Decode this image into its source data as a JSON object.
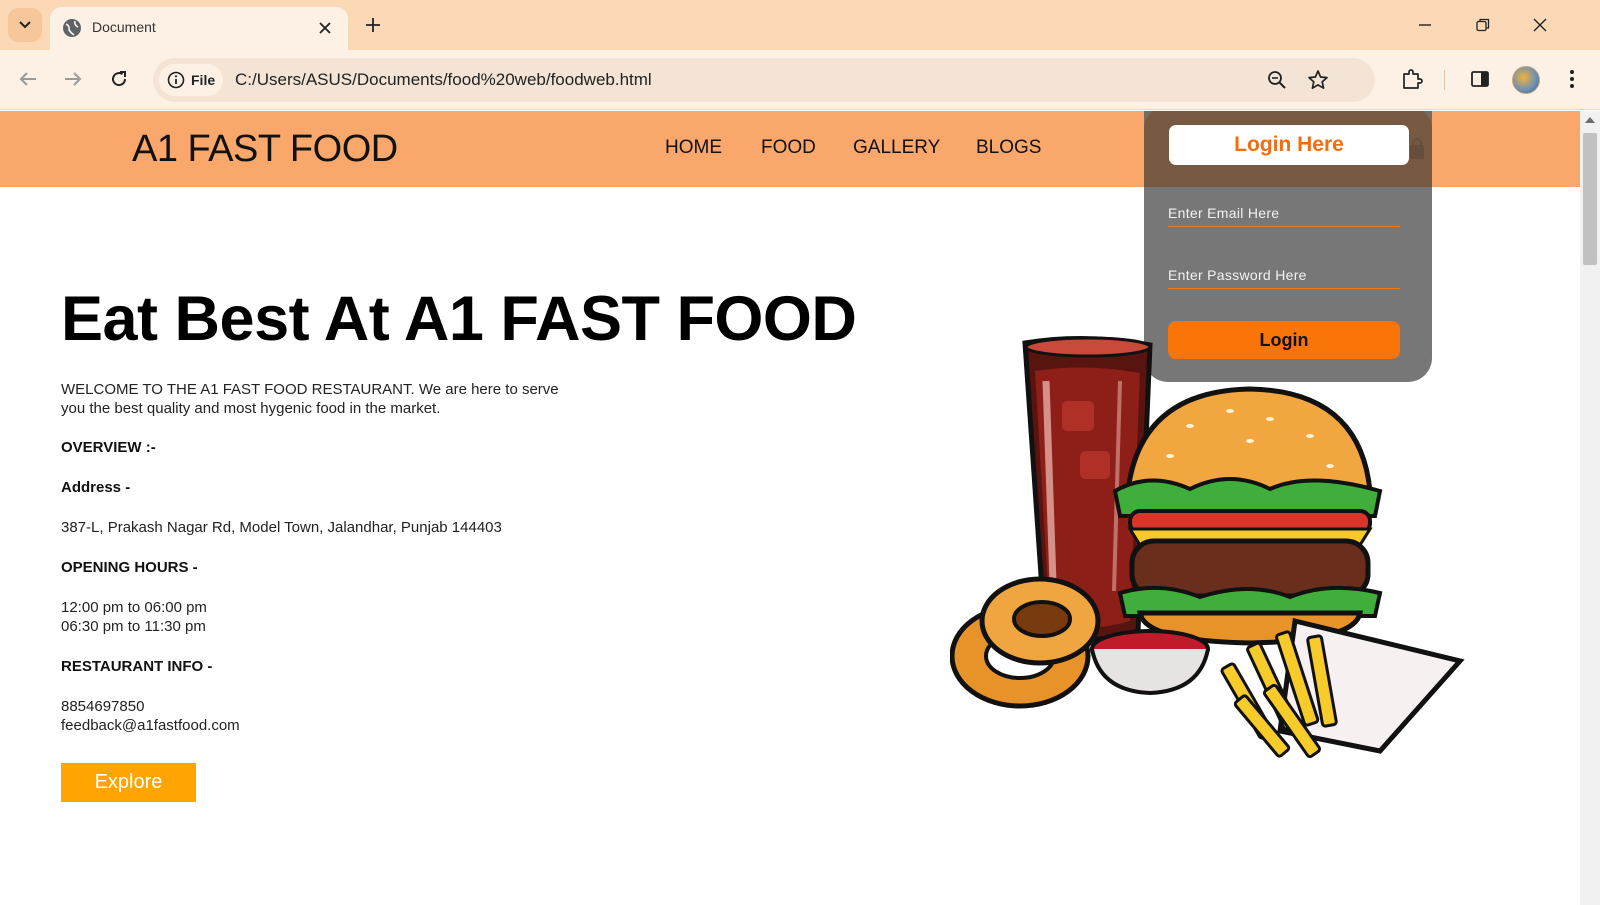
{
  "browser": {
    "tab_title": "Document",
    "file_chip_label": "File",
    "url": "C:/Users/ASUS/Documents/food%20web/foodweb.html"
  },
  "site": {
    "logo": "A1 FAST FOOD",
    "nav": [
      "HOME",
      "FOOD",
      "GALLERY",
      "BLOGS"
    ]
  },
  "login": {
    "title": "Login Here",
    "email_placeholder": "Enter Email Here",
    "password_placeholder": "Enter Password Here",
    "button": "Login"
  },
  "hero": {
    "title": "Eat Best At A1 FAST FOOD",
    "intro_line1": "WELCOME TO THE A1 FAST FOOD RESTAURANT. We are here to serve",
    "intro_line2": "you the best quality and most hygenic food in the market.",
    "overview_heading": "OVERVIEW :-",
    "address_heading": "Address -",
    "address": "387-L, Prakash Nagar Rd, Model Town, Jalandhar, Punjab 144403",
    "hours_heading": "OPENING HOURS -",
    "hours_1": "12:00 pm to 06:00 pm",
    "hours_2": "06:30 pm to 11:30 pm",
    "info_heading": "RESTAURANT INFO -",
    "phone": "8854697850",
    "email": "feedback@a1fastfood.com",
    "explore_button": "Explore"
  },
  "colors": {
    "header_bg": "#f9a76b",
    "login_accent": "#f97508",
    "explore_bg": "#ffa400",
    "chrome_bg": "#fcd9b6"
  }
}
